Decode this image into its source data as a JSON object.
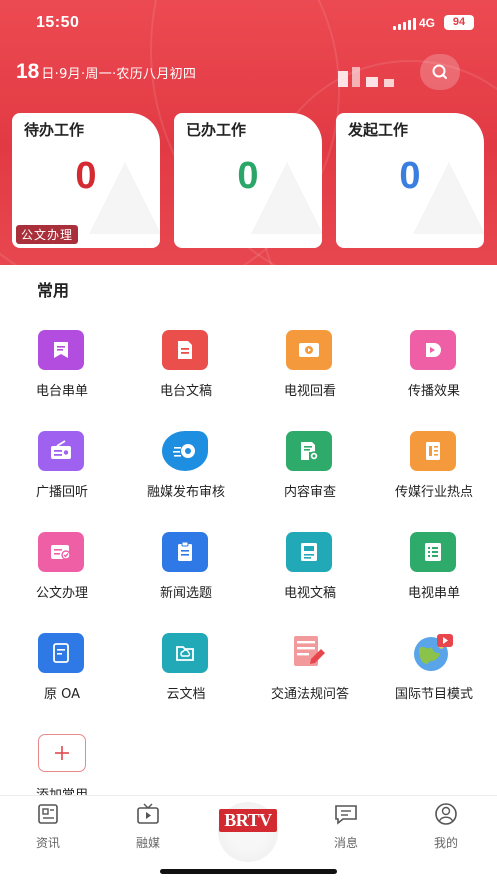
{
  "status_bar": {
    "time": "15:50",
    "network": "4G",
    "battery": "94"
  },
  "header": {
    "date_day": "18",
    "date_rest": "日·9月·周一·农历八月初四"
  },
  "cards": [
    {
      "title": "待办工作",
      "count": "0",
      "color": "#d42a31",
      "tag": "公文办理"
    },
    {
      "title": "已办工作",
      "count": "0",
      "color": "#2aa768"
    },
    {
      "title": "发起工作",
      "count": "0",
      "color": "#3a7fe0"
    }
  ],
  "section": {
    "title": "常用"
  },
  "tiles": [
    {
      "label": "电台串单",
      "icon": "bookmark-icon",
      "color": "#b34de0"
    },
    {
      "label": "电台文稿",
      "icon": "document-icon",
      "color": "#ea4f4b"
    },
    {
      "label": "电视回看",
      "icon": "tv-replay-icon",
      "color": "#f59a3c"
    },
    {
      "label": "传播效果",
      "icon": "effect-icon",
      "color": "#ee5fa5"
    },
    {
      "label": "广播回听",
      "icon": "radio-icon",
      "color": "#9f62f0"
    },
    {
      "label": "融媒发布审核",
      "icon": "media-publish-icon",
      "color": "#1e8fe0"
    },
    {
      "label": "内容审查",
      "icon": "content-review-icon",
      "color": "#2eab6a"
    },
    {
      "label": "传媒行业热点",
      "icon": "news-hot-icon",
      "color": "#f59a3c"
    },
    {
      "label": "公文办理",
      "icon": "doc-process-icon",
      "color": "#ee5fa5"
    },
    {
      "label": "新闻选题",
      "icon": "clipboard-icon",
      "color": "#2f79e6"
    },
    {
      "label": "电视文稿",
      "icon": "tv-script-icon",
      "color": "#22a9b8"
    },
    {
      "label": "电视串单",
      "icon": "list-icon",
      "color": "#2eab6a"
    },
    {
      "label": "原 OA",
      "icon": "oa-icon",
      "color": "#2f79e6"
    },
    {
      "label": "云文档",
      "icon": "cloud-folder-icon",
      "color": "#22a9b8"
    },
    {
      "label": "交通法规问答",
      "icon": "traffic-law-icon",
      "color": "#e8464c"
    },
    {
      "label": "国际节目模式",
      "icon": "globe-icon",
      "color": "#3e8de0"
    },
    {
      "label": "添加常用",
      "icon": "plus-icon",
      "color": "#e04a4f"
    }
  ],
  "tabbar": {
    "items": [
      {
        "label": "资讯",
        "icon": "news-icon"
      },
      {
        "label": "融媒",
        "icon": "media-icon"
      },
      {
        "label": "BRTV",
        "icon": "brtv-logo"
      },
      {
        "label": "消息",
        "icon": "message-icon"
      },
      {
        "label": "我的",
        "icon": "profile-icon"
      }
    ]
  }
}
